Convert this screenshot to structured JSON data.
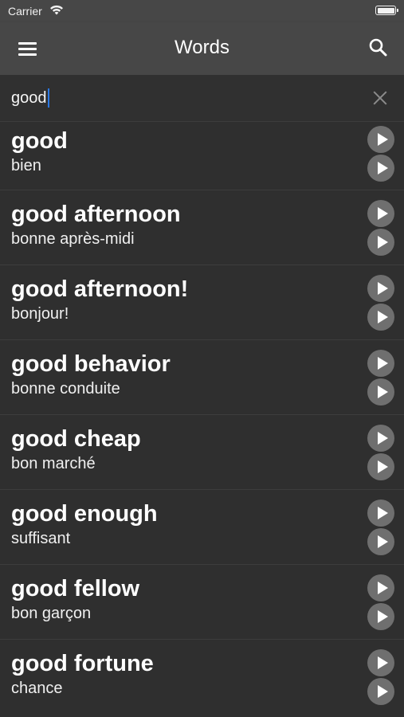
{
  "status_bar": {
    "carrier": "Carrier",
    "wifi_icon": "wifi-icon",
    "battery_icon": "battery-icon"
  },
  "nav": {
    "title": "Words",
    "menu_icon": "hamburger-menu-icon",
    "search_icon": "search-icon"
  },
  "search": {
    "value": "good",
    "clear_icon": "close-icon"
  },
  "colors": {
    "background": "#2f2f2f",
    "nav_background": "#474747",
    "play_button": "#6f6f6f",
    "cursor": "#2a78e4"
  },
  "words": [
    {
      "word": "good",
      "translation": "bien"
    },
    {
      "word": "good afternoon",
      "translation": "bonne après-midi"
    },
    {
      "word": "good afternoon!",
      "translation": "bonjour!"
    },
    {
      "word": "good behavior",
      "translation": "bonne conduite"
    },
    {
      "word": "good cheap",
      "translation": "bon marché"
    },
    {
      "word": "good enough",
      "translation": "suffisant"
    },
    {
      "word": "good fellow",
      "translation": "bon garçon"
    },
    {
      "word": "good fortune",
      "translation": "chance"
    }
  ]
}
